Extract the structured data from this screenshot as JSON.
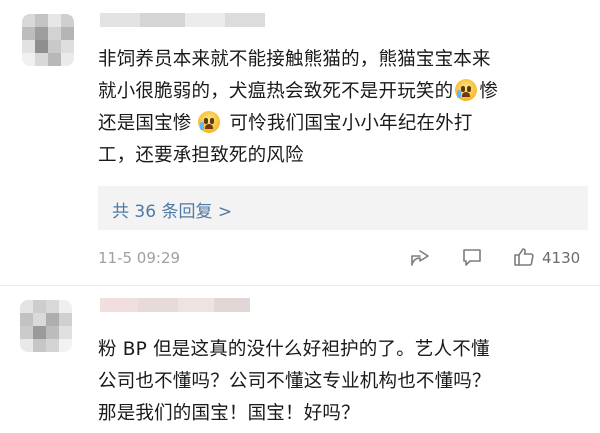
{
  "comments": [
    {
      "lines": [
        "非饲养员本来就不能接触熊猫的，熊猫宝宝本来",
        "就小很脆弱的，犬瘟热会致死不是开玩笑的",
        "惨",
        "还是国宝惨",
        "可怜我们国宝小小年纪在外打",
        "工，还要承担致死的风险"
      ],
      "emoji_icon": "crying-face-emoji",
      "replies_label": "共 36 条回复 >",
      "date": "11-5 09:29",
      "like_count": "4130"
    },
    {
      "lines": [
        "粉 BP 但是这真的没什么好袒护的了。艺人不懂",
        "公司也不懂吗？公司不懂这专业机构也不懂吗？",
        "那是我们的国宝！国宝！好吗？"
      ]
    }
  ],
  "icons": {
    "share": "share-icon",
    "comment": "comment-icon",
    "like": "thumbs-up-icon"
  },
  "colors": {
    "link": "#4f7aa3",
    "meta": "#a0a0a0",
    "reply_bg": "#f3f3f3"
  }
}
